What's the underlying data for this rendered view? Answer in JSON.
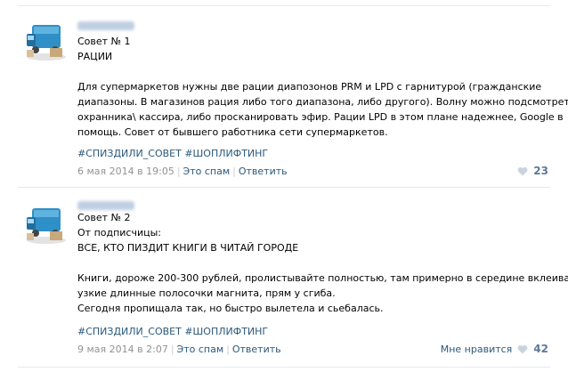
{
  "posts": [
    {
      "title": "Совет № 1",
      "lines": [
        "РАЦИИ",
        "",
        "Для супермаркетов нужны две рации диапозонов PRM и LPD с гарнитурой (гражданские",
        "диапазоны. В магазинов рация либо того диапазона, либо другого). Волну можно подсмотреть у",
        "охранника\\ кассира, либо просканировать эфир. Рации LPD в этом плане надежнее, Google в",
        "помощь. Совет от бывшего работника сети супермаркетов."
      ],
      "hashtags": [
        "#СПИЗДИЛИ_СОВЕТ",
        "#ШОПЛИФТИНГ"
      ],
      "date": "6 мая 2014 в 19:05",
      "spam_label": "Это спам",
      "reply_label": "Ответить",
      "like_label": "",
      "likes": "23"
    },
    {
      "title": "Совет № 2",
      "lines": [
        "От подписчицы:",
        "ВСЕ, КТО ПИЗДИТ КНИГИ В ЧИТАЙ ГОРОДЕ",
        "",
        "Книги, дороже 200-300 рублей, пролистывайте полностью, там примерно в середине вклеивают",
        "узкие длинные полосочки магнита, прям у сгиба.",
        "Сегодня пропищала так, но быстро вылетела и сьебалась."
      ],
      "hashtags": [
        "#СПИЗДИЛИ_СОВЕТ",
        "#ШОПЛИФТИНГ"
      ],
      "date": "9 мая 2014 в 2:07",
      "spam_label": "Это спам",
      "reply_label": "Ответить",
      "like_label": "Мне нравится",
      "likes": "42"
    }
  ],
  "colors": {
    "link": "#2b587a",
    "meta": "#939393",
    "like_count": "#5d7a98"
  }
}
